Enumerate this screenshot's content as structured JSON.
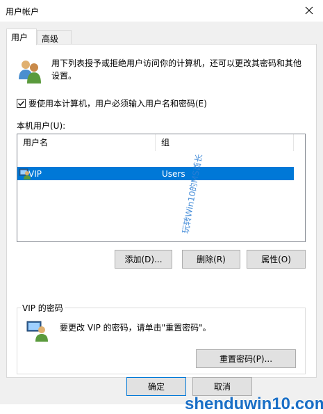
{
  "window": {
    "title": "用户帐户"
  },
  "tabs": [
    {
      "label": "用户",
      "active": true
    },
    {
      "label": "高级",
      "active": false
    }
  ],
  "intro_text": "用下列表授予或拒绝用户访问你的计算机，还可以更改其密码和其他设置。",
  "require_login": {
    "label": "要使用本计算机，用户必须输入用户名和密码(E)",
    "checked": true
  },
  "local_users": {
    "label": "本机用户(U):",
    "columns": [
      "用户名",
      "组"
    ],
    "rows": [
      {
        "name": "VIP",
        "group": "Users",
        "selected": true
      }
    ]
  },
  "buttons": {
    "add": "添加(D)...",
    "remove": "删除(R)",
    "properties": "属性(O)"
  },
  "password_group": {
    "title": "VIP 的密码",
    "text": "要更改 VIP 的密码，请单击\"重置密码\"。",
    "reset_button": "重置密码(P)..."
  },
  "footer": {
    "ok": "确定",
    "cancel": "取消"
  },
  "watermark": "玩转Win10的MS酋长",
  "logo_text": "shenduwin10.com",
  "colors": {
    "selection": "#0078d7",
    "tab_panel_border": "#d9d9d9",
    "logo": "#1a6fc6"
  },
  "icons": [
    "users-icon",
    "user-icon",
    "vip-user-icon",
    "close-icon",
    "check-icon"
  ]
}
